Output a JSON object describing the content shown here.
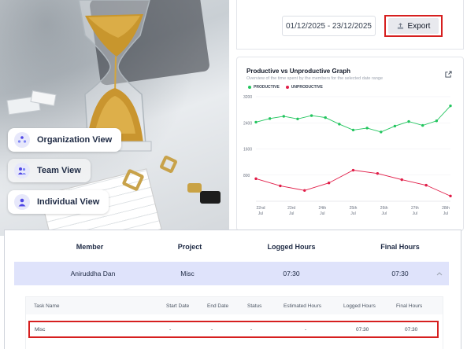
{
  "views": [
    {
      "label": "Organization View"
    },
    {
      "label": "Team View"
    },
    {
      "label": "Individual View"
    }
  ],
  "toolbar": {
    "date_range": "01/12/2025 - 23/12/2025",
    "export_label": "Export"
  },
  "chart_card": {
    "title": "Productive vs Unproductive Graph",
    "subtitle": "Overview of the time spent by the members for the selected date range",
    "legend": [
      "PRODUCTIVE",
      "UNPRODUCTIVE"
    ]
  },
  "chart_data": {
    "type": "line",
    "x": [
      "22nd Jul",
      "23rd Jul",
      "24th Jul",
      "25th Jul",
      "26th Jul",
      "27th Jul",
      "28th Jul"
    ],
    "ylim": [
      0,
      3200
    ],
    "yticks": [
      "3200",
      "2400",
      "1600",
      "800"
    ],
    "series": [
      {
        "name": "PRODUCTIVE",
        "color": "#22c55e",
        "values": [
          2420,
          2530,
          2600,
          2520,
          2620,
          2560,
          2360,
          2180,
          2240,
          2120,
          2300,
          2440,
          2320,
          2460,
          2920
        ]
      },
      {
        "name": "UNPRODUCTIVE",
        "color": "#e11d48",
        "values": [
          690,
          470,
          330,
          560,
          950,
          850,
          660,
          490,
          160
        ]
      }
    ]
  },
  "table": {
    "headers": [
      "Member",
      "Project",
      "Logged Hours",
      "Final Hours"
    ],
    "row": {
      "member": "Aniruddha Dan",
      "project": "Misc",
      "logged": "07:30",
      "final": "07:30"
    },
    "detail_headers": [
      "Task Name",
      "Start Date",
      "End Date",
      "Status",
      "Estimated Hours",
      "Logged Hours",
      "Final Hours"
    ],
    "task": {
      "name": "Misc",
      "start": "-",
      "end": "-",
      "status": "-",
      "estimated": "-",
      "logged": "07:30",
      "final": "07:30"
    }
  }
}
